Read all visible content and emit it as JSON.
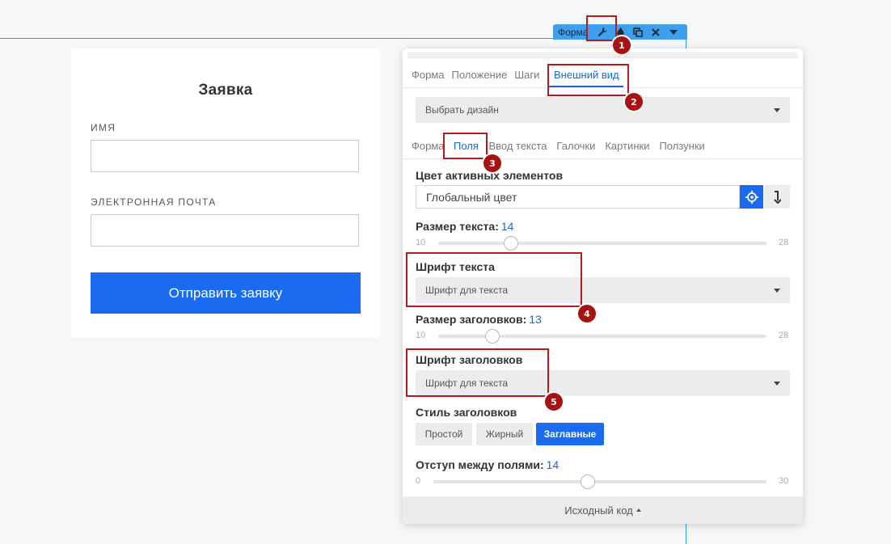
{
  "toolbar": {
    "label": "Форма",
    "icons": [
      "wrench-icon",
      "drop-icon",
      "copy-icon",
      "close-icon",
      "chevron-down-icon"
    ]
  },
  "form": {
    "title": "Заявка",
    "fields": [
      {
        "label": "ИМЯ",
        "value": ""
      },
      {
        "label": "ЭЛЕКТРОННАЯ ПОЧТА",
        "value": ""
      }
    ],
    "submit_label": "Отправить заявку"
  },
  "panel": {
    "tabs": [
      "Форма",
      "Положение",
      "Шаги",
      "Внешний вид"
    ],
    "active_tab": "Внешний вид",
    "design_select": "Выбрать дизайн",
    "subtabs": [
      "Форма",
      "Поля",
      "Ввод текста",
      "Галочки",
      "Картинки",
      "Ползунки"
    ],
    "active_subtab": "Поля",
    "active_color": {
      "label": "Цвет активных элементов",
      "value": "Глобальный цвет"
    },
    "text_size": {
      "label": "Размер текста:",
      "value": 14,
      "min": 10,
      "max": 28
    },
    "text_font": {
      "label": "Шрифт текста",
      "value": "Шрифт для текста"
    },
    "heading_size": {
      "label": "Размер заголовков:",
      "value": 13,
      "min": 10,
      "max": 28
    },
    "heading_font": {
      "label": "Шрифт заголовков",
      "value": "Шрифт для текста"
    },
    "heading_style": {
      "label": "Стиль заголовков",
      "options": [
        "Простой",
        "Жирный",
        "Заглавные"
      ],
      "active": "Заглавные"
    },
    "field_gap": {
      "label": "Отступ между полями:",
      "value": 14,
      "min": 0,
      "max": 30
    },
    "footer": "Исходный код"
  },
  "annotations": [
    "1",
    "2",
    "3",
    "4",
    "5"
  ],
  "colors": {
    "accent": "#1a6bf0",
    "guide": "#2d9bea",
    "annotation": "#b51b1b"
  }
}
